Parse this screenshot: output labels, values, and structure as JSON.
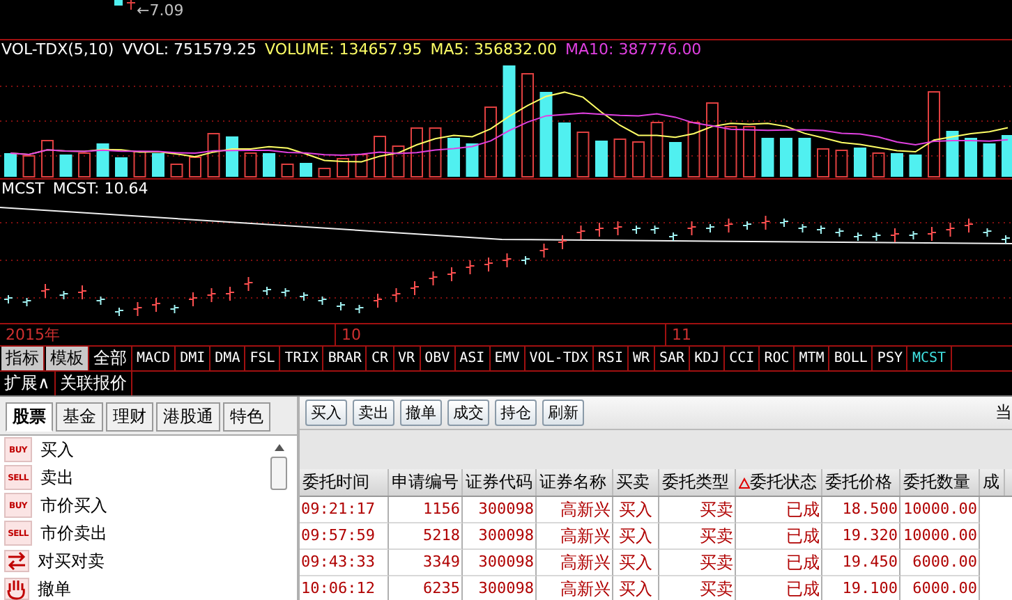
{
  "price_chart": {
    "marker_label": "←7.09"
  },
  "volume_panel": {
    "legend": [
      {
        "text": "VOL-TDX(5,10)",
        "color": "#ffffff"
      },
      {
        "text": "VVOL: 751579.25",
        "color": "#ffffff"
      },
      {
        "text": "VOLUME: 134657.95",
        "color": "#ffff66"
      },
      {
        "text": "MA5: 356832.00",
        "color": "#ffff66"
      },
      {
        "text": "MA10: 387776.00",
        "color": "#e040e0"
      }
    ]
  },
  "mcst_panel": {
    "legend": [
      {
        "text": "MCST",
        "color": "#ffffff"
      },
      {
        "text": "MCST: 10.64",
        "color": "#ffffff"
      }
    ]
  },
  "time_axis": [
    "2015年",
    "10",
    "11"
  ],
  "indicator_bar": {
    "buttons": [
      "指标",
      "模板"
    ],
    "tabs": [
      {
        "label": "全部",
        "selected": false
      },
      {
        "label": "MACD",
        "selected": false
      },
      {
        "label": "DMI",
        "selected": false
      },
      {
        "label": "DMA",
        "selected": false
      },
      {
        "label": "FSL",
        "selected": false
      },
      {
        "label": "TRIX",
        "selected": false
      },
      {
        "label": "BRAR",
        "selected": false
      },
      {
        "label": "CR",
        "selected": false
      },
      {
        "label": "VR",
        "selected": false
      },
      {
        "label": "OBV",
        "selected": false
      },
      {
        "label": "ASI",
        "selected": false
      },
      {
        "label": "EMV",
        "selected": false
      },
      {
        "label": "VOL-TDX",
        "selected": false
      },
      {
        "label": "RSI",
        "selected": false
      },
      {
        "label": "WR",
        "selected": false
      },
      {
        "label": "SAR",
        "selected": false
      },
      {
        "label": "KDJ",
        "selected": false
      },
      {
        "label": "CCI",
        "selected": false
      },
      {
        "label": "ROC",
        "selected": false
      },
      {
        "label": "MTM",
        "selected": false
      },
      {
        "label": "BOLL",
        "selected": false
      },
      {
        "label": "PSY",
        "selected": false
      },
      {
        "label": "MCST",
        "selected": true
      }
    ]
  },
  "extension_bar": [
    "扩展∧",
    "关联报价"
  ],
  "trade_panel": {
    "category_tabs": [
      {
        "label": "股票",
        "selected": true
      },
      {
        "label": "基金",
        "selected": false
      },
      {
        "label": "理财",
        "selected": false
      },
      {
        "label": "港股通",
        "selected": false
      },
      {
        "label": "特色",
        "selected": false
      }
    ],
    "menu": [
      {
        "label": "买入",
        "kind": "buy",
        "badge": "BUY"
      },
      {
        "label": "卖出",
        "kind": "sell",
        "badge": "SELL"
      },
      {
        "label": "市价买入",
        "kind": "buy",
        "badge": "BUY"
      },
      {
        "label": "市价卖出",
        "kind": "sell",
        "badge": "SELL"
      },
      {
        "label": "对买对卖",
        "kind": "swap"
      },
      {
        "label": "撤单",
        "kind": "cancel"
      }
    ],
    "toolbar": [
      "买入",
      "卖出",
      "撤单",
      "成交",
      "持仓",
      "刷新"
    ],
    "toolbar_cut_label": "当",
    "table": {
      "columns": [
        {
          "label": "委托时间",
          "sorted": false
        },
        {
          "label": "申请编号",
          "sorted": false
        },
        {
          "label": "证券代码",
          "sorted": false
        },
        {
          "label": "证券名称",
          "sorted": false
        },
        {
          "label": "买卖",
          "sorted": false
        },
        {
          "label": "委托类型",
          "sorted": false
        },
        {
          "label": "委托状态",
          "sorted": true
        },
        {
          "label": "委托价格",
          "sorted": false
        },
        {
          "label": "委托数量",
          "sorted": false
        },
        {
          "label": "成",
          "sorted": false
        }
      ],
      "rows": [
        [
          "09:21:17",
          "1156",
          "300098",
          "高新兴",
          "买入",
          "买卖",
          "已成",
          "18.500",
          "10000.00"
        ],
        [
          "09:57:59",
          "5218",
          "300098",
          "高新兴",
          "买入",
          "买卖",
          "已成",
          "19.320",
          "10000.00"
        ],
        [
          "09:43:33",
          "3349",
          "300098",
          "高新兴",
          "买入",
          "买卖",
          "已成",
          "19.450",
          "6000.00"
        ],
        [
          "10:06:12",
          "6235",
          "300098",
          "高新兴",
          "买入",
          "买卖",
          "已成",
          "19.100",
          "6000.00"
        ]
      ]
    }
  }
}
